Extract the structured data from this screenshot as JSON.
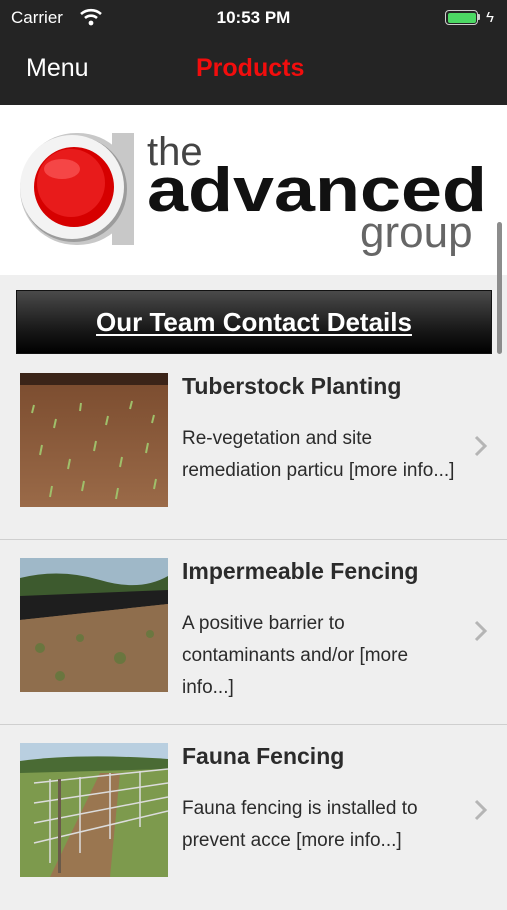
{
  "status": {
    "carrier": "Carrier",
    "time": "10:53 PM"
  },
  "nav": {
    "menu_label": "Menu",
    "products_label": "Products"
  },
  "logo": {
    "word_the": "the",
    "word_advanced": "advanced",
    "word_group": "group"
  },
  "banner": {
    "label": "Our Team Contact Details"
  },
  "items": [
    {
      "title": "Tuberstock Planting",
      "description": "Re-vegetation and site remediation particu [more info...]"
    },
    {
      "title": "Impermeable Fencing",
      "description": "A positive barrier to contaminants and/or [more info...]"
    },
    {
      "title": "Fauna Fencing",
      "description": "Fauna fencing is installed to prevent acce [more info...]"
    }
  ],
  "colors": {
    "bar_bg": "#242424",
    "accent_red": "#f20d0d",
    "list_bg": "#efefef"
  }
}
